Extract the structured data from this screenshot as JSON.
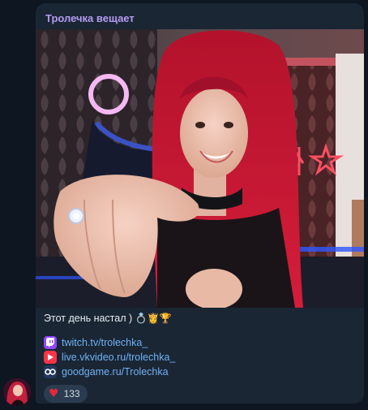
{
  "channel": {
    "sender_name": "Тролечка вещает"
  },
  "post": {
    "caption_text": "Этот день настал )",
    "caption_emoji": "💍👸🏆",
    "links": [
      {
        "text": "twitch.tv/trolechka_",
        "icon": "twitch-icon",
        "color": "#9146ff"
      },
      {
        "text": "live.vkvideo.ru/trolechka_",
        "icon": "vk-video-icon",
        "color": "#ff3347"
      },
      {
        "text": "goodgame.ru/Trolechka",
        "icon": "goodgame-icon",
        "color": "#23365b"
      }
    ],
    "reaction": {
      "emoji": "♥",
      "count": "133"
    }
  },
  "colors": {
    "background": "#0e1621",
    "bubble": "#1a2634",
    "sender": "#b49cf0",
    "link": "#71b1f3"
  }
}
